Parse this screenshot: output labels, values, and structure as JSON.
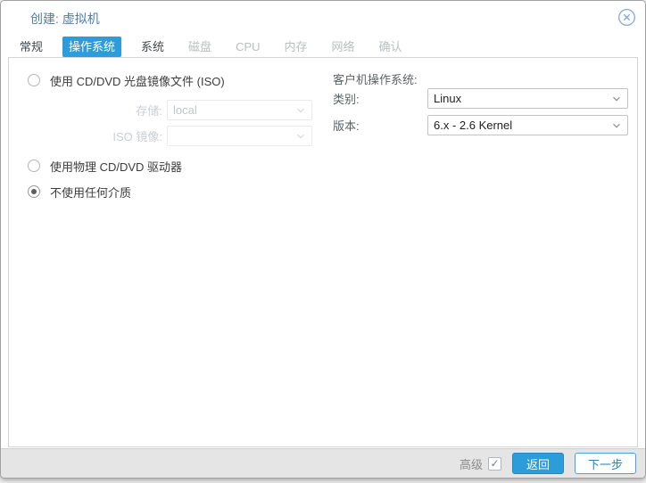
{
  "dialog": {
    "title": "创建: 虚拟机"
  },
  "tabs": [
    {
      "label": "常规",
      "state": "normal"
    },
    {
      "label": "操作系统",
      "state": "active"
    },
    {
      "label": "系统",
      "state": "normal"
    },
    {
      "label": "磁盘",
      "state": "disabled"
    },
    {
      "label": "CPU",
      "state": "disabled"
    },
    {
      "label": "内存",
      "state": "disabled"
    },
    {
      "label": "网络",
      "state": "disabled"
    },
    {
      "label": "确认",
      "state": "disabled"
    }
  ],
  "media": {
    "option_iso": {
      "label": "使用 CD/DVD 光盘镜像文件 (ISO)",
      "selected": false
    },
    "option_drive": {
      "label": "使用物理 CD/DVD 驱动器",
      "selected": false
    },
    "option_none": {
      "label": "不使用任何介质",
      "selected": true
    },
    "storage": {
      "label": "存储:",
      "value": "local",
      "disabled": true
    },
    "iso": {
      "label": "ISO 镜像:",
      "value": "",
      "disabled": true
    }
  },
  "guest_os": {
    "heading": "客户机操作系统:",
    "type": {
      "label": "类别:",
      "value": "Linux"
    },
    "version": {
      "label": "版本:",
      "value": "6.x - 2.6 Kernel"
    }
  },
  "footer": {
    "advanced_label": "高级",
    "advanced_checked": true,
    "check_glyph": "✓",
    "back_label": "返回",
    "next_label": "下一步"
  },
  "colors": {
    "accent": "#2d9cdb",
    "title_text": "#4d7cae",
    "footer_bg": "#e5e5e5"
  }
}
